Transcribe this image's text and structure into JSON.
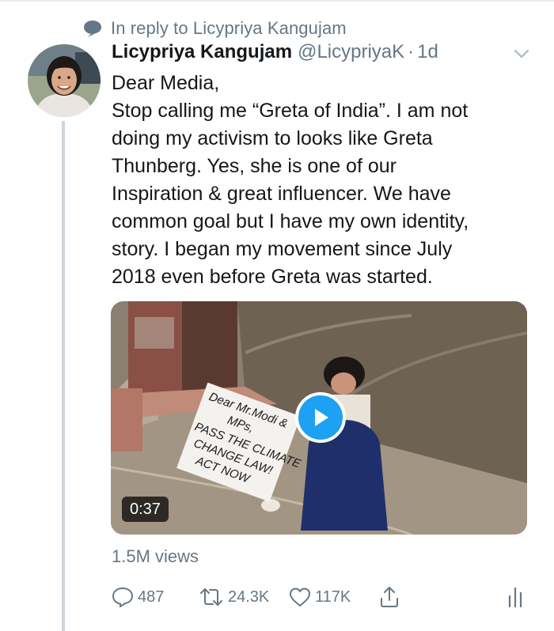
{
  "reply": {
    "label": "In reply to Licypriya Kangujam",
    "icon": "speech-bubble-icon"
  },
  "tweet": {
    "author_name": "Licypriya Kangujam",
    "handle": "@LicypriyaK",
    "separator": "·",
    "time": "1d",
    "lines": [
      "Dear Media,",
      "Stop calling me “Greta of India”. I am not",
      "doing my activism to looks like Greta",
      "Thunberg. Yes, she is one of our",
      "Inspiration & great influencer. We have",
      "common goal but I have my own identity,",
      "story. I began my movement since July",
      "2018 even before Greta was started."
    ]
  },
  "media": {
    "sign_lines": [
      "Dear Mr.Modi &",
      "MPs,",
      "PASS THE CLIMATE",
      "CHANGE LAW!",
      "ACT NOW"
    ],
    "duration": "0:37"
  },
  "stats": {
    "views": "1.5M views"
  },
  "actions": {
    "reply_count": "487",
    "retweet_count": "24.3K",
    "like_count": "117K"
  },
  "colors": {
    "accent": "#1da1f2",
    "secondary_text": "#657786",
    "primary_text": "#14171a",
    "thread_line": "#ccd6dd"
  }
}
